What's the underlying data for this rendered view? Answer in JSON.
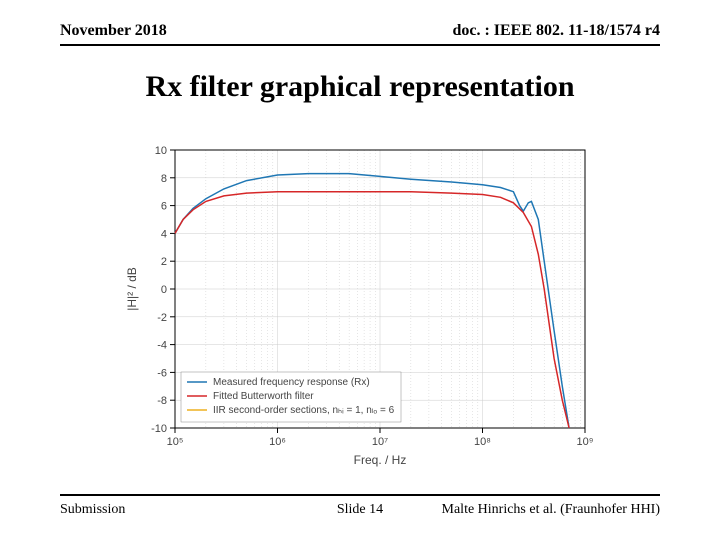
{
  "header": {
    "left": "November 2018",
    "right": "doc. : IEEE 802. 11-18/1574 r4"
  },
  "title": "Rx filter graphical representation",
  "footer": {
    "left": "Submission",
    "center": "Slide 14",
    "right": "Malte Hinrichs et al. (Fraunhofer HHI)"
  },
  "chart_data": {
    "type": "line",
    "xlabel": "Freq. / Hz",
    "ylabel": "|H|² / dB",
    "xscale": "log",
    "xlim": [
      100000.0,
      1000000000.0
    ],
    "ylim": [
      -10,
      10
    ],
    "xticks": [
      100000.0,
      1000000.0,
      10000000.0,
      100000000.0,
      1000000000.0
    ],
    "yticks": [
      -10,
      -8,
      -6,
      -4,
      -2,
      0,
      2,
      4,
      6,
      8,
      10
    ],
    "xtick_labels": [
      "10⁵",
      "10⁶",
      "10⁷",
      "10⁸",
      "10⁹"
    ],
    "legend": {
      "position": "lower left",
      "entries": [
        {
          "label": "Measured frequency response (Rx)",
          "color": "#1f77b4"
        },
        {
          "label": "Fitted Butterworth filter",
          "color": "#d62728"
        },
        {
          "label": "IIR second-order sections, nₕᵢ = 1, nₗₒ = 6",
          "color": "#edb120"
        }
      ]
    },
    "series": [
      {
        "name": "Measured frequency response (Rx)",
        "color": "#1f77b4",
        "x": [
          100000.0,
          120000.0,
          150000.0,
          200000.0,
          300000.0,
          500000.0,
          1000000.0,
          2000000.0,
          5000000.0,
          10000000.0,
          20000000.0,
          50000000.0,
          100000000.0,
          150000000.0,
          200000000.0,
          230000000.0,
          250000000.0,
          280000000.0,
          300000000.0,
          350000000.0,
          400000000.0,
          500000000.0,
          600000000.0,
          700000000.0
        ],
        "y": [
          4.0,
          5.0,
          5.8,
          6.5,
          7.2,
          7.8,
          8.2,
          8.3,
          8.3,
          8.1,
          7.9,
          7.7,
          7.5,
          7.3,
          7.0,
          6.0,
          5.6,
          6.2,
          6.3,
          5.0,
          2.0,
          -3.0,
          -7.0,
          -10.0
        ]
      },
      {
        "name": "Fitted Butterworth filter",
        "color": "#d62728",
        "x": [
          100000.0,
          120000.0,
          150000.0,
          200000.0,
          300000.0,
          500000.0,
          1000000.0,
          2000000.0,
          5000000.0,
          10000000.0,
          20000000.0,
          50000000.0,
          100000000.0,
          150000000.0,
          200000000.0,
          250000000.0,
          300000000.0,
          350000000.0,
          400000000.0,
          500000000.0,
          600000000.0,
          700000000.0
        ],
        "y": [
          4.0,
          5.0,
          5.7,
          6.3,
          6.7,
          6.9,
          7.0,
          7.0,
          7.0,
          7.0,
          7.0,
          6.9,
          6.8,
          6.6,
          6.2,
          5.5,
          4.5,
          2.5,
          0.0,
          -5.0,
          -8.0,
          -10.0
        ]
      }
    ]
  }
}
